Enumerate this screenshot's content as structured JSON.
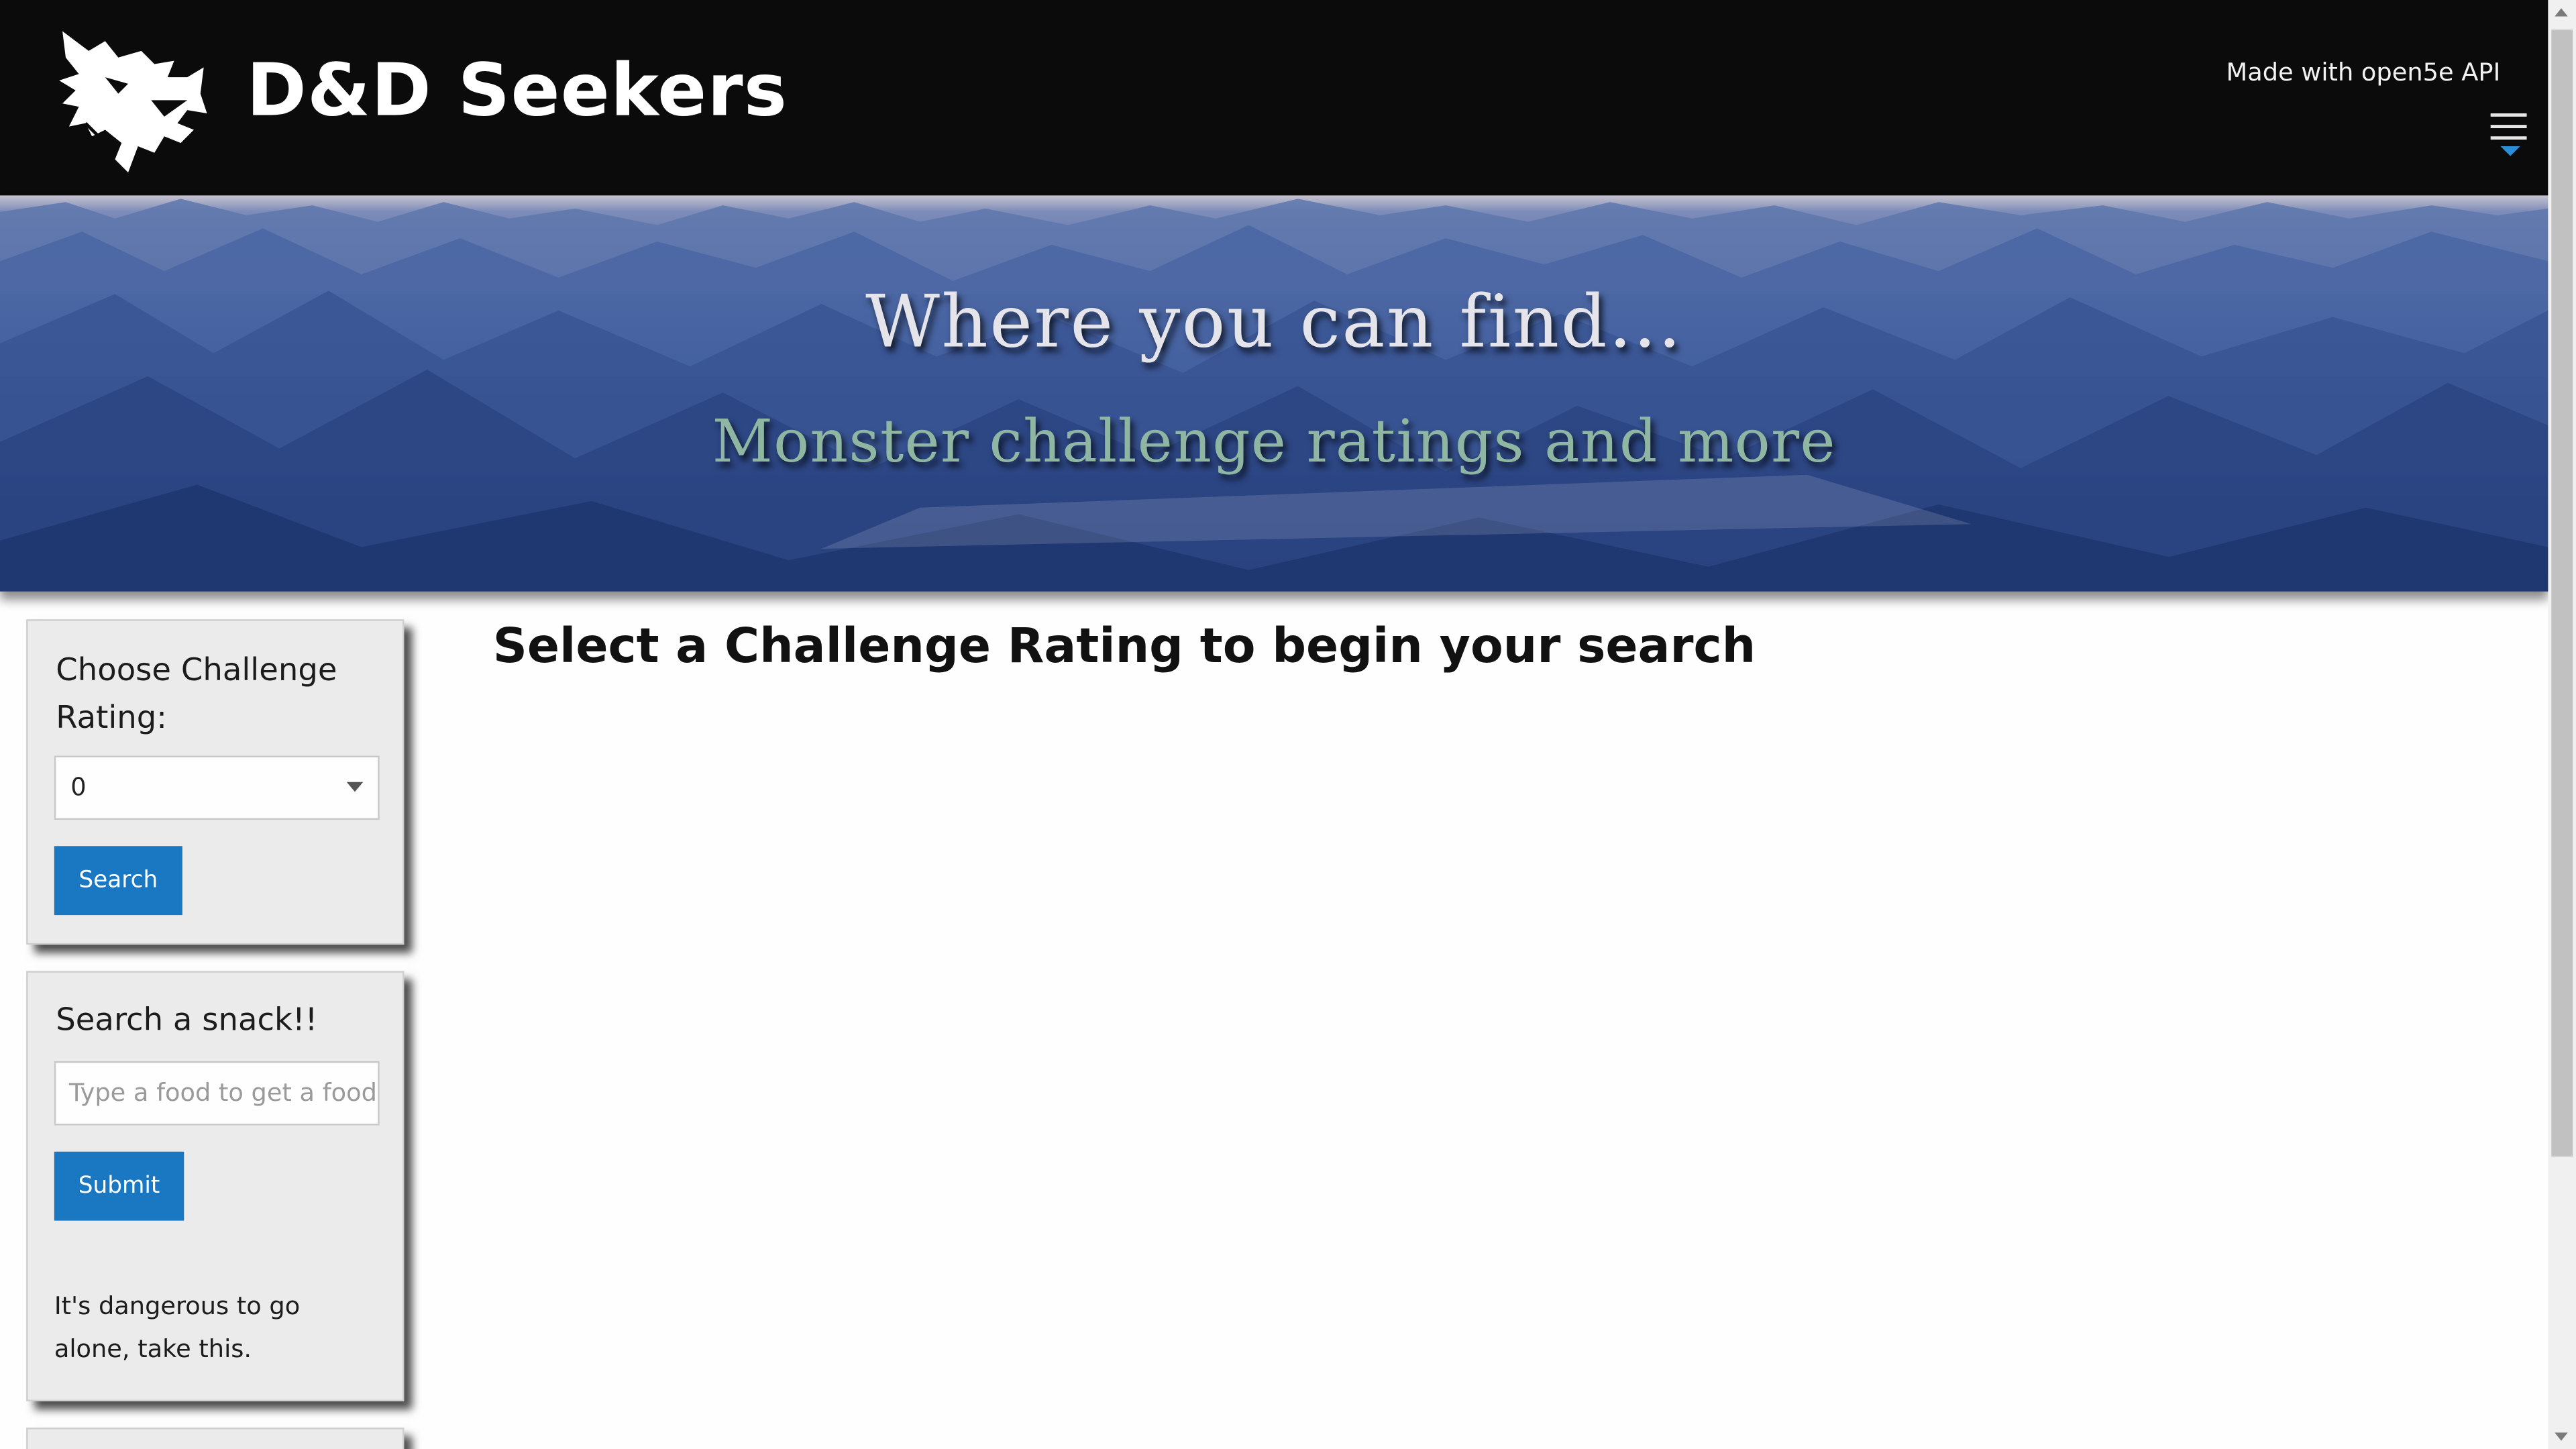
{
  "header": {
    "brand": "D&D Seekers",
    "credit": "Made with open5e API"
  },
  "hero": {
    "title": "Where you can find...",
    "subtitle": "Monster challenge ratings and more"
  },
  "challenge_card": {
    "label": "Choose Challenge Rating:",
    "select_value": "0",
    "search_button": "Search"
  },
  "snack_card": {
    "label": "Search a snack!!",
    "input_placeholder": "Type a food to get a food",
    "submit_button": "Submit",
    "tip": "It's dangerous to go alone, take this."
  },
  "main": {
    "heading": "Select a Challenge Rating to begin your search"
  },
  "icons": {
    "logo": "dragon-head-logo-icon",
    "menu": "hamburger-menu-icon"
  },
  "colors": {
    "header_bg": "#0b0b0b",
    "button_blue": "#1a78c2",
    "subtitle_green": "#8fb6a2"
  }
}
